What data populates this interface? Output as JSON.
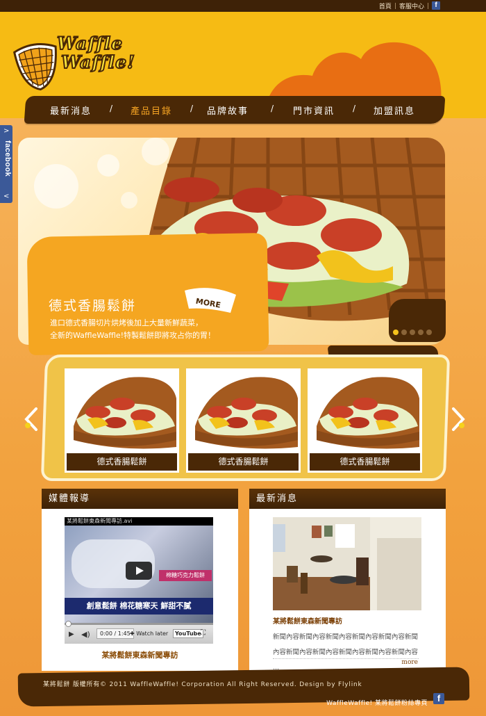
{
  "top_links": {
    "home": "首頁",
    "service": "客服中心",
    "fb_icon": "f"
  },
  "logo": {
    "line1": "Waffle",
    "line2": "Waffle!"
  },
  "nav": [
    "最新消息",
    "產品目錄",
    "品牌故事",
    "門市資訊",
    "加盟訊息"
  ],
  "nav_active": 1,
  "facebook_tab": {
    "label": "facebook",
    "up": ">",
    "down": "<"
  },
  "hero": {
    "title": "德式香腸鬆餅",
    "desc_line1": "進口德式香腸切片烘烤後加上大量新鮮蔬菜，",
    "desc_line2": "全新的WaffleWaffle!特製鬆餅即將攻占你的胃！",
    "more": "MORE",
    "slides": 5,
    "active_slide": 0
  },
  "products": [
    {
      "caption": "德式香腸鬆餅"
    },
    {
      "caption": "德式香腸鬆餅"
    },
    {
      "caption": "德式香腸鬆餅"
    }
  ],
  "media": {
    "heading": "媒體報導",
    "video_title": "某將鬆餅東森新聞專訪.avi",
    "video_banner": "創意鬆餅 棉花糖寒天 鮮甜不膩",
    "video_side": "棉糖巧克力鬆餅",
    "video_time": "0:00 / 1:45",
    "watch_later": "Watch later",
    "youtube": "YouTube",
    "link": "某將鬆餅東森新聞專訪"
  },
  "news": {
    "heading": "最新消息",
    "title": "某將鬆餅東森新聞專訪",
    "body_line1": "新聞內容新聞內容新聞內容新聞內容新聞內容新聞",
    "body_line2": "內容新聞內容新聞內容新聞內容新聞內容新聞內容 ...",
    "more": "more"
  },
  "footer": {
    "copyright": "某將鬆餅 版權所有© 2011 WaffleWaffle! Corporation All Right Reserved. Design by Flylink",
    "fanpage": "WaffleWaffle! 某將鬆餅粉絲專頁",
    "fb_icon": "f"
  },
  "colors": {
    "brown": "#4a2806",
    "orange": "#f5a621",
    "yellow": "#f6bb14",
    "accent": "#f6a423",
    "facebook": "#3b5998"
  }
}
